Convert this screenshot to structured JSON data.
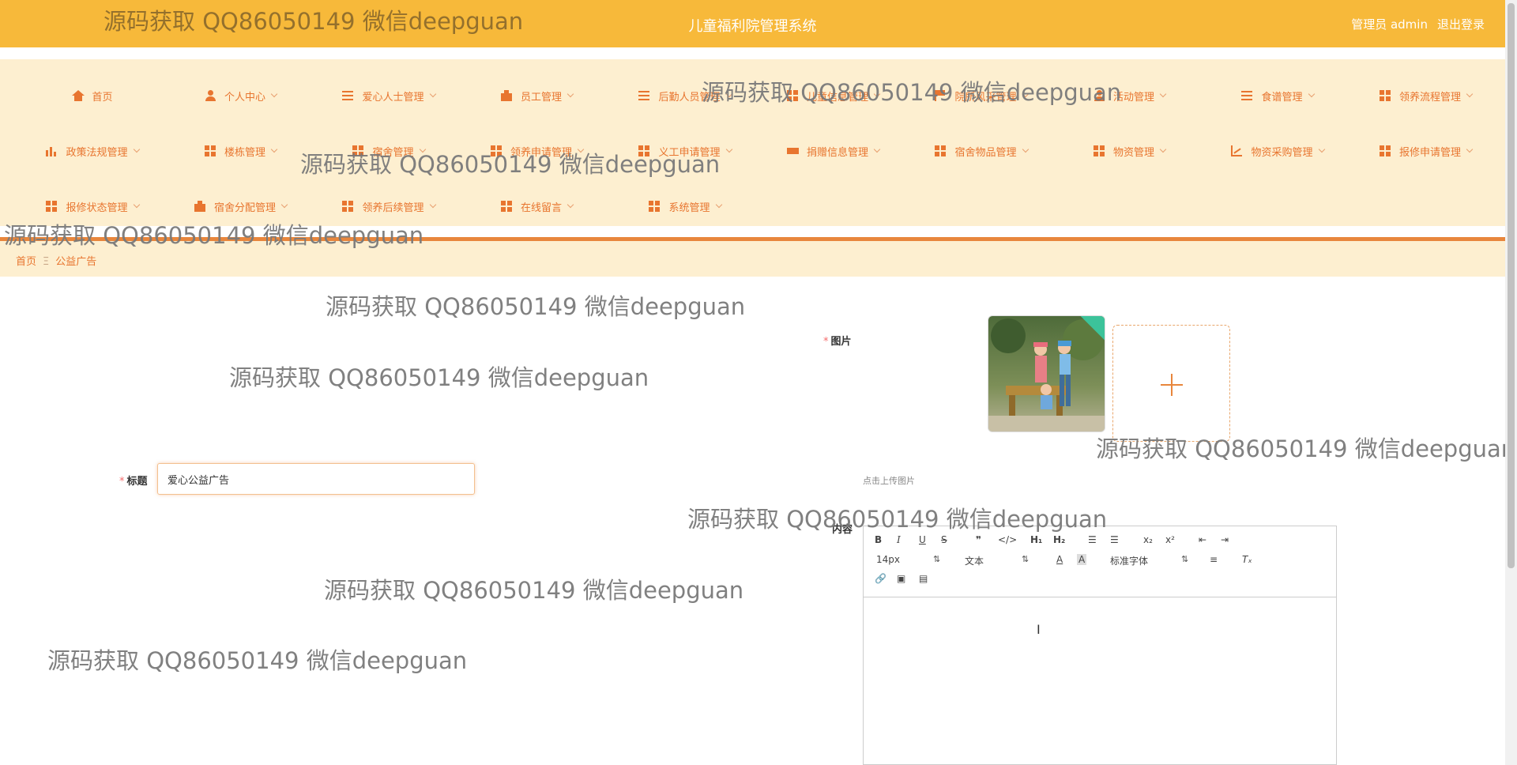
{
  "header": {
    "title": "儿童福利院管理系统",
    "user_label": "管理员 admin",
    "logout_label": "退出登录"
  },
  "nav": {
    "items": [
      {
        "label": "首页",
        "icon": "home-icon"
      },
      {
        "label": "个人中心",
        "icon": "user-icon"
      },
      {
        "label": "爱心人士管理",
        "icon": "sliders-icon"
      },
      {
        "label": "员工管理",
        "icon": "bag-icon"
      },
      {
        "label": "后勤人员管理",
        "icon": "list-icon"
      },
      {
        "label": "儿童信息管理",
        "icon": "grid-icon"
      },
      {
        "label": "院所风采管理",
        "icon": "flag-icon"
      },
      {
        "label": "活动管理",
        "icon": "user-icon"
      },
      {
        "label": "食谱管理",
        "icon": "list-icon"
      },
      {
        "label": "领养流程管理",
        "icon": "grid-icon"
      },
      {
        "label": "政策法规管理",
        "icon": "chart-icon"
      },
      {
        "label": "楼栋管理",
        "icon": "grid-icon"
      },
      {
        "label": "宿舍管理",
        "icon": "grid-icon"
      },
      {
        "label": "领养申请管理",
        "icon": "grid-icon"
      },
      {
        "label": "义工申请管理",
        "icon": "grid-icon"
      },
      {
        "label": "捐赠信息管理",
        "icon": "ticket-icon"
      },
      {
        "label": "宿舍物品管理",
        "icon": "grid-icon"
      },
      {
        "label": "物资管理",
        "icon": "grid-icon"
      },
      {
        "label": "物资采购管理",
        "icon": "line-chart-icon"
      },
      {
        "label": "报修申请管理",
        "icon": "grid-icon"
      },
      {
        "label": "报修状态管理",
        "icon": "grid-icon"
      },
      {
        "label": "宿舍分配管理",
        "icon": "bag-icon"
      },
      {
        "label": "领养后续管理",
        "icon": "grid-icon"
      },
      {
        "label": "在线留言",
        "icon": "grid-icon"
      },
      {
        "label": "系统管理",
        "icon": "grid-icon"
      }
    ]
  },
  "breadcrumb": {
    "home": "首页",
    "sep": "Ξ",
    "current": "公益广告"
  },
  "form": {
    "image_label": "图片",
    "title_label": "标题",
    "title_value": "爱心公益广告",
    "upload_tip": "点击上传图片",
    "content_label": "内容",
    "required_mark": "*"
  },
  "editor": {
    "font_size": "14px",
    "block_type": "文本",
    "font_family": "标准字体"
  },
  "watermark": "源码获取 QQ86050149 微信deepguan",
  "colors": {
    "header": "#f7b93a",
    "nav_bg": "#fdefd0",
    "accent": "#e8752f"
  }
}
